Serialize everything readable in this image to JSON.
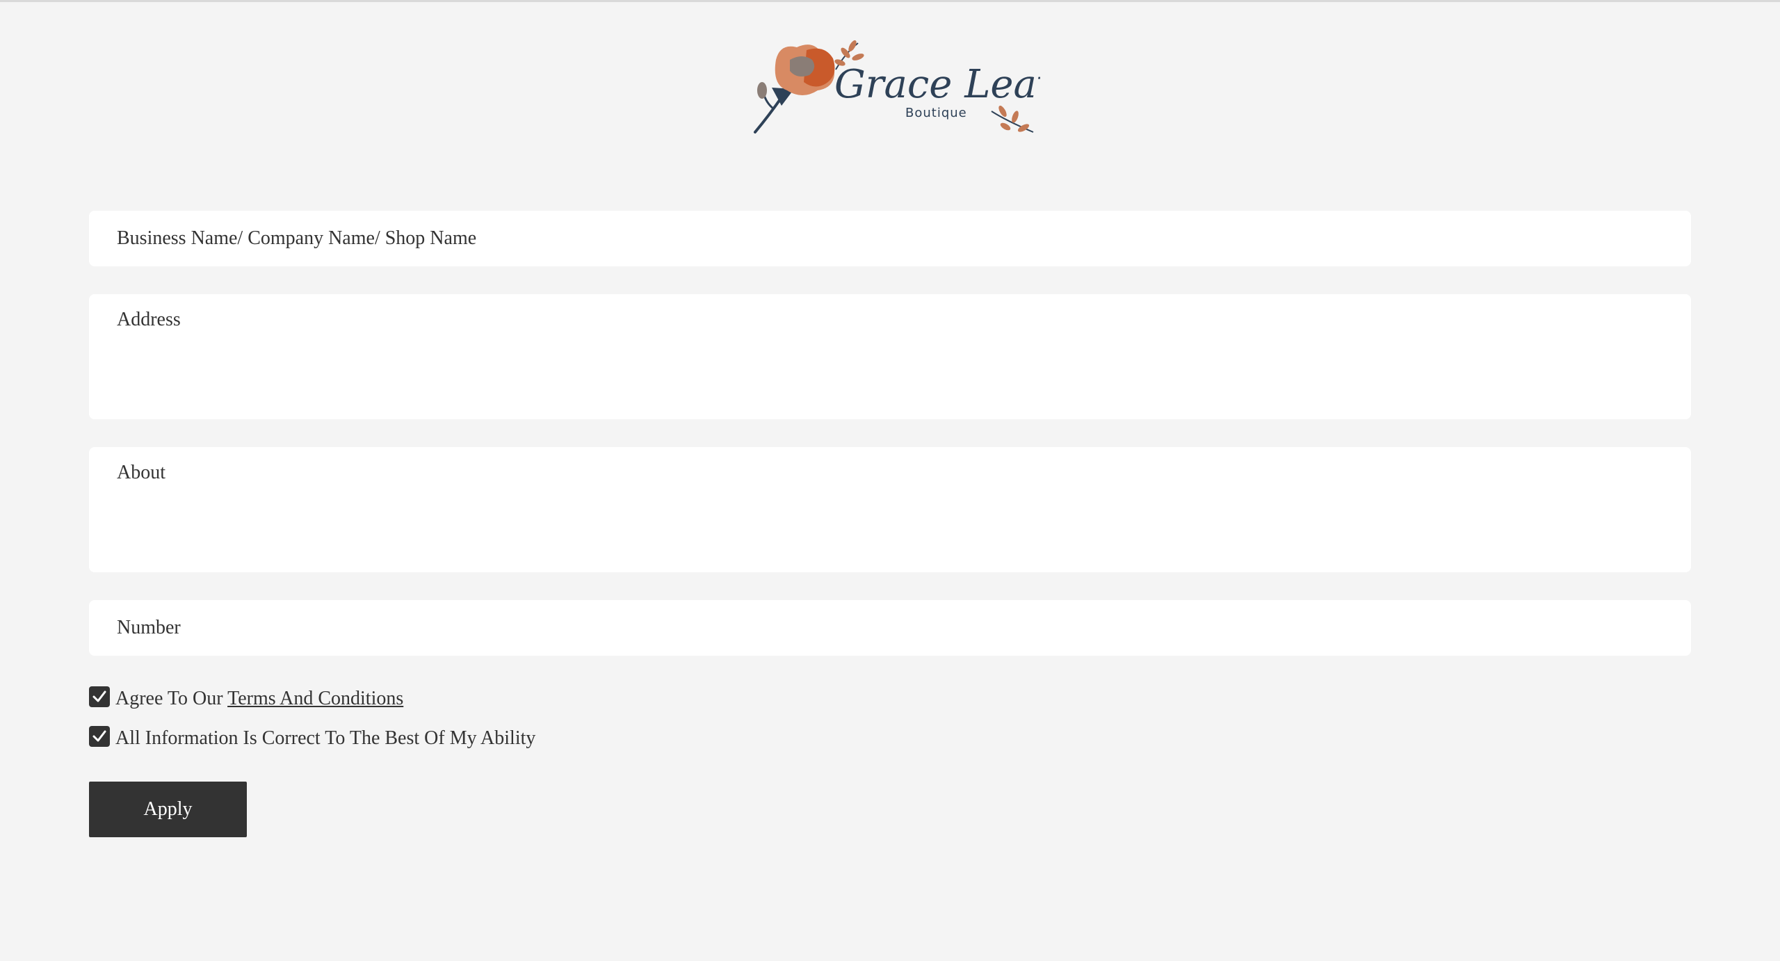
{
  "brand": {
    "name": "Grace Leaves",
    "tagline": "Boutique",
    "colors": {
      "ink": "#2e4157",
      "flower_light": "#d88a63",
      "flower_dark": "#c95a2b",
      "flower_center": "#8a7d76",
      "leaf": "#c47a55"
    }
  },
  "form": {
    "business_name": {
      "placeholder": "Business Name/ Company Name/ Shop Name",
      "value": ""
    },
    "address": {
      "placeholder": "Address",
      "value": ""
    },
    "about": {
      "placeholder": "About",
      "value": ""
    },
    "number": {
      "placeholder": "Number",
      "value": ""
    },
    "agree_terms": {
      "checked": true,
      "label_prefix": "Agree To Our ",
      "link_text": "Terms And Conditions"
    },
    "info_correct": {
      "checked": true,
      "label": "All Information Is Correct To The Best Of My Ability"
    },
    "submit_label": "Apply"
  },
  "theme": {
    "background": "#f4f4f4",
    "field_background": "#ffffff",
    "button_background": "#333333",
    "text": "#333333"
  }
}
